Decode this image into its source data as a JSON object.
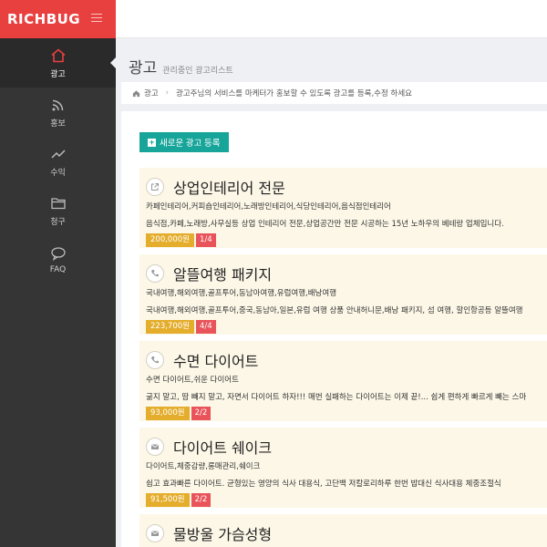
{
  "brand": {
    "logo": "RICHBUG"
  },
  "sidebar": {
    "items": [
      {
        "label": "광고",
        "icon": "home-icon",
        "active": true
      },
      {
        "label": "홍보",
        "icon": "rss-icon",
        "active": false
      },
      {
        "label": "수익",
        "icon": "trend-icon",
        "active": false
      },
      {
        "label": "청구",
        "icon": "folder-icon",
        "active": false
      },
      {
        "label": "FAQ",
        "icon": "chat-icon",
        "active": false
      }
    ]
  },
  "header": {
    "title": "광고",
    "subtitle": "관리중인 광고리스트"
  },
  "breadcrumb": {
    "home": "광고",
    "text": "광고주님의 서비스를 마케터가 홍보할 수 있도록 광고를 등록,수정 하세요"
  },
  "toolbar": {
    "new_label": "새로운 광고 등록"
  },
  "ads": [
    {
      "icon": "external-link-icon",
      "title": "상업인테리어 전문",
      "tags": "카페인테리어,커피숍인테리어,노래방인테리어,식당인테리어,음식점인테리어",
      "desc": "음식점,카페,노래방,사무실등 상업 인테리어 전문,상업공간만 전문 시공하는 15년 노하우의 베테랑 업체입니다.",
      "price": "200,000원",
      "count": "1/4"
    },
    {
      "icon": "phone-icon",
      "title": "알뜰여행 패키지",
      "tags": "국내여행,해외여행,골프투어,동남아여행,유럽여행,배낭여행",
      "desc": "국내여행,해외여행,골프투어,중국,동남아,일본,유럽 여행 상품 안내허니문,배낭 패키지, 섬 여행, 할인항공등 알뜰여행",
      "price": "223,700원",
      "count": "4/4"
    },
    {
      "icon": "phone-icon",
      "title": "수면 다이어트",
      "tags": "수면 다이어트,쉬운 다이어트",
      "desc": "굶지 말고, 땀 빼지 말고, 자면서 다이어트 하자!!! 매번 실패하는 다이어트는 이제 끝!... 쉽게 편하게 빠르게 빼는 스마",
      "price": "93,000원",
      "count": "2/2"
    },
    {
      "icon": "mail-icon",
      "title": "다이어트 쉐이크",
      "tags": "다이어트,체중감량,롱매관리,쉐이크",
      "desc": "쉽고 효과빠른 다이어트. 균형있는 영양의 식사 대용식, 고단백 저칼로리하루 한번 밥대신 식사대용 체중조절식",
      "price": "91,500원",
      "count": "2/2"
    },
    {
      "icon": "mail-icon",
      "title": "물방울 가슴성형",
      "tags": "",
      "desc": "",
      "price": "",
      "count": ""
    }
  ]
}
